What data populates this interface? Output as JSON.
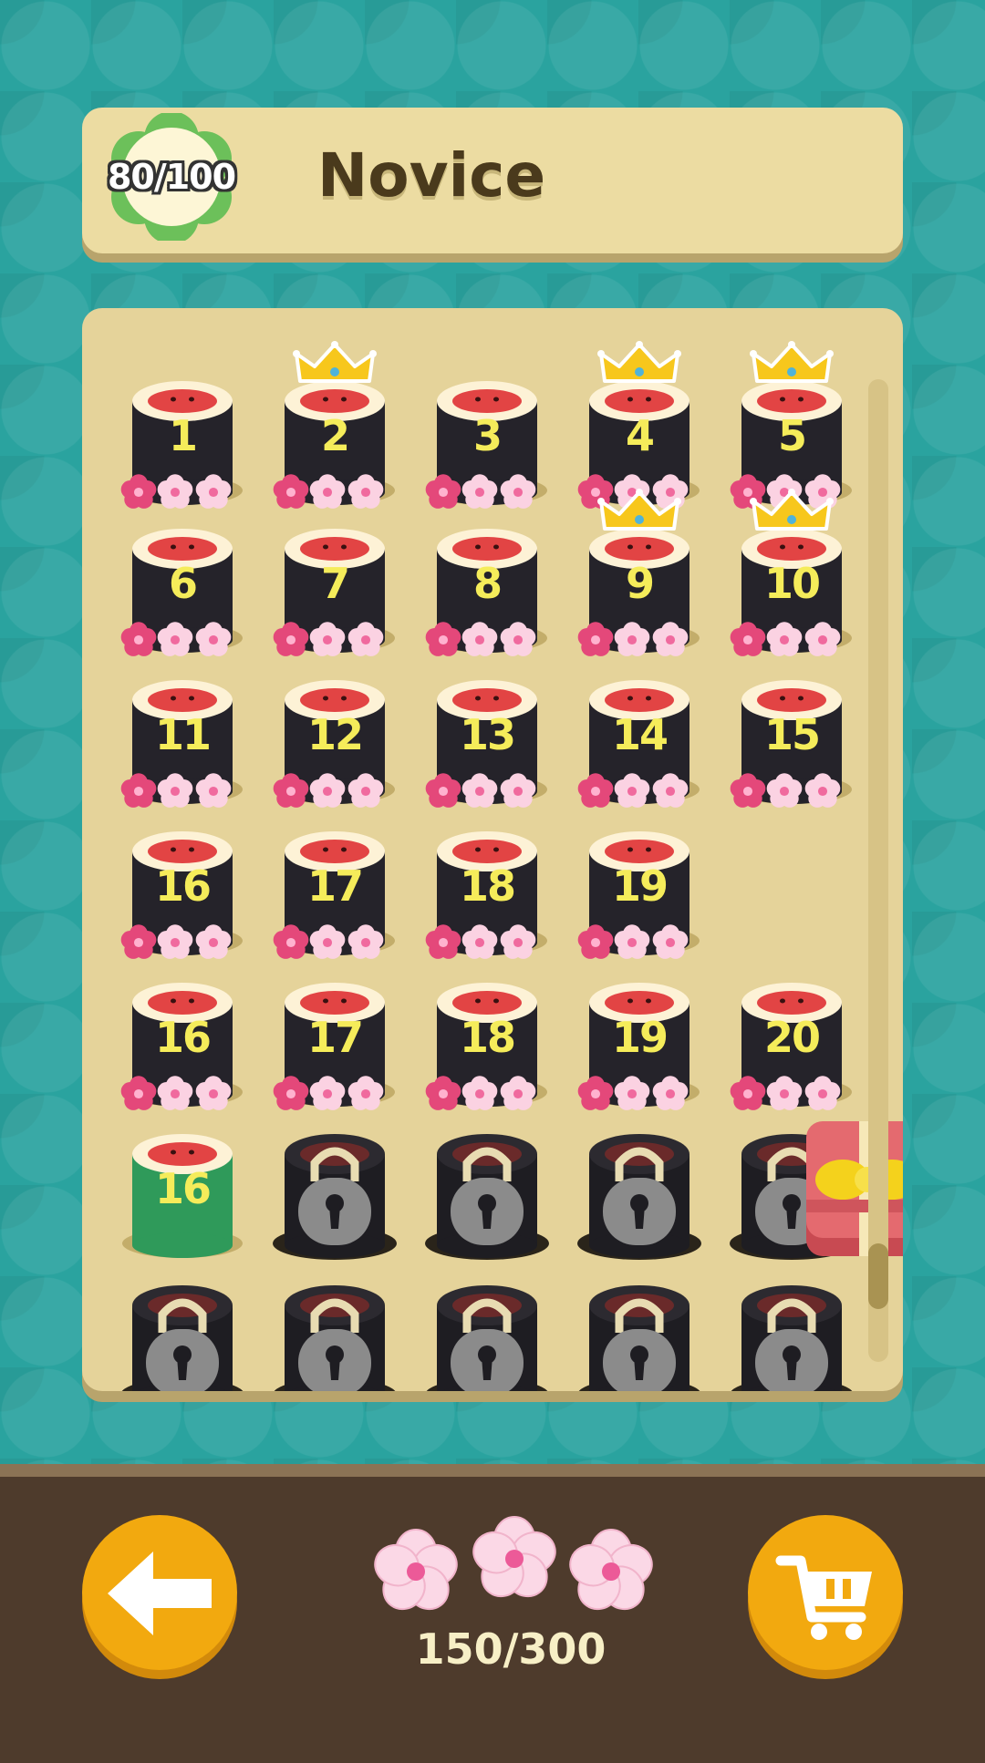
{
  "header": {
    "progress": "80/100",
    "title": "Novice"
  },
  "levels": [
    {
      "num": "1",
      "state": "played",
      "crown": false
    },
    {
      "num": "2",
      "state": "played",
      "crown": true
    },
    {
      "num": "3",
      "state": "played",
      "crown": false
    },
    {
      "num": "4",
      "state": "played",
      "crown": true
    },
    {
      "num": "5",
      "state": "played",
      "crown": true
    },
    {
      "num": "6",
      "state": "played",
      "crown": false
    },
    {
      "num": "7",
      "state": "played",
      "crown": false
    },
    {
      "num": "8",
      "state": "played",
      "crown": false
    },
    {
      "num": "9",
      "state": "played",
      "crown": true
    },
    {
      "num": "10",
      "state": "played",
      "crown": true
    },
    {
      "num": "11",
      "state": "played",
      "crown": false
    },
    {
      "num": "12",
      "state": "played",
      "crown": false
    },
    {
      "num": "13",
      "state": "played",
      "crown": false
    },
    {
      "num": "14",
      "state": "played",
      "crown": false
    },
    {
      "num": "15",
      "state": "played",
      "crown": false
    },
    {
      "num": "16",
      "state": "played",
      "crown": false
    },
    {
      "num": "17",
      "state": "played",
      "crown": false
    },
    {
      "num": "18",
      "state": "played",
      "crown": false
    },
    {
      "num": "19",
      "state": "played",
      "crown": false
    },
    {
      "num": "",
      "state": "gift",
      "crown": false
    },
    {
      "num": "16",
      "state": "played",
      "crown": false
    },
    {
      "num": "17",
      "state": "played",
      "crown": false
    },
    {
      "num": "18",
      "state": "played",
      "crown": false
    },
    {
      "num": "19",
      "state": "played",
      "crown": false
    },
    {
      "num": "20",
      "state": "played",
      "crown": false
    },
    {
      "num": "16",
      "state": "current",
      "crown": false
    },
    {
      "num": "",
      "state": "locked",
      "crown": false
    },
    {
      "num": "",
      "state": "locked",
      "crown": false
    },
    {
      "num": "",
      "state": "locked",
      "crown": false
    },
    {
      "num": "",
      "state": "locked",
      "crown": false
    },
    {
      "num": "",
      "state": "locked",
      "crown": false
    },
    {
      "num": "",
      "state": "locked",
      "crown": false
    },
    {
      "num": "",
      "state": "locked",
      "crown": false
    },
    {
      "num": "",
      "state": "locked",
      "crown": false
    },
    {
      "num": "",
      "state": "locked",
      "crown": false
    }
  ],
  "footer": {
    "back_icon": "arrow-left-icon",
    "shop_icon": "cart-icon",
    "stars_earned": 150,
    "stars_total": 300,
    "score_text": "150/300"
  },
  "colors": {
    "background": "#2aa39f",
    "panel": "#e5d39a",
    "button": "#f2a90f",
    "sushi_number": "#f5ec5a",
    "bottom_bar": "#4e3b2c"
  }
}
